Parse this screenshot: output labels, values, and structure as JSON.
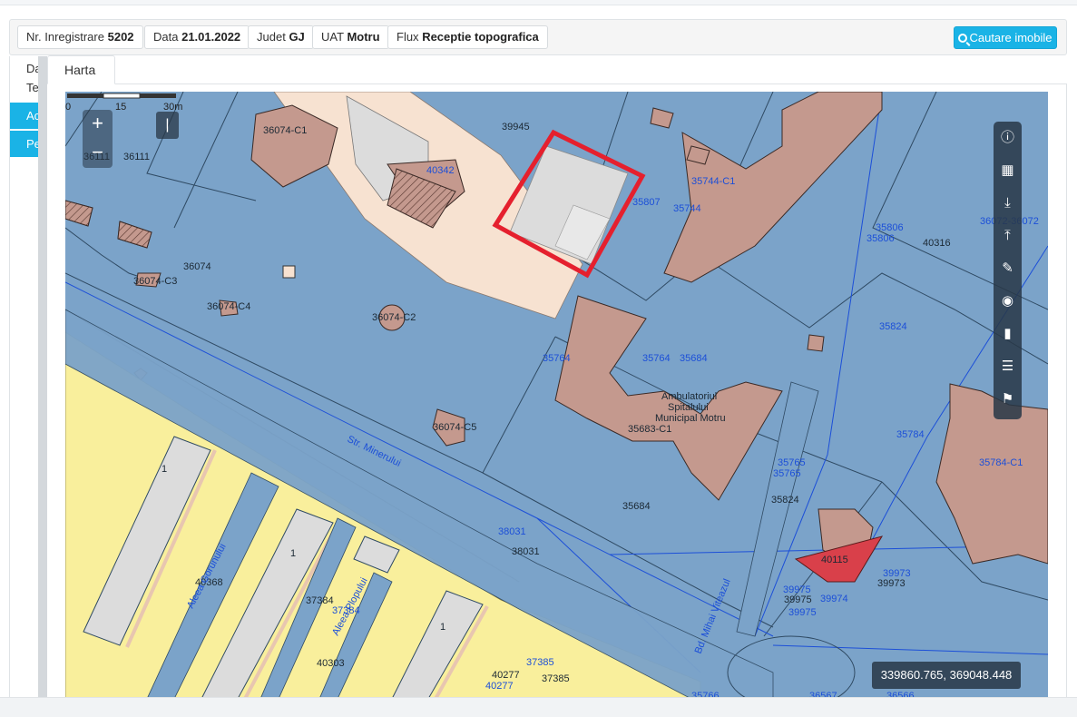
{
  "infobar": {
    "items": [
      {
        "label": "Nr. Inregistrare",
        "value": "5202"
      },
      {
        "label": "Data",
        "value": "21.01.2022"
      },
      {
        "label": "Judet",
        "value": "GJ"
      },
      {
        "label": "UAT",
        "value": "Motru"
      },
      {
        "label": "Flux",
        "value": "Receptie topografica"
      }
    ],
    "search_button": "Cautare imobile",
    "search_icon": "search-icon"
  },
  "left_panel": {
    "text1": "Da",
    "text2": "Te",
    "blue1": "Ac",
    "blue2": "Pe"
  },
  "tabs": [
    {
      "label": "Harta"
    }
  ],
  "map": {
    "zoom_in": "+",
    "zoom_out": "−",
    "layer_toggle": "|",
    "tools": [
      "info-icon",
      "table-icon",
      "download-icon",
      "upload-icon",
      "edit-icon",
      "globe-icon",
      "map-icon",
      "layers-icon",
      "tag-icon"
    ],
    "scale_labels": [
      "0",
      "15",
      "30m"
    ],
    "coordinates": "339860.765, 369048.448",
    "labels": {
      "p36074c1a": "36074-C1",
      "p39945": "39945",
      "p36111a": "36111",
      "p36111b": "36111",
      "p40342": "40342",
      "p35807": "35807",
      "p35744": "35744",
      "p35744c": "35744-C1",
      "p36074": "36074",
      "p36074c3": "36074-C3",
      "p36074c4": "36074-C4",
      "p36074c2": "36074-C2",
      "p36074c5": "36074-C5",
      "p35806a": "35806",
      "p35806b": "35806",
      "p40316": "40316",
      "p36072": "36072-36072",
      "p35824a": "35824",
      "p35764a": "35764",
      "p35764b": "35764",
      "p35684a": "35684",
      "p35684b": "35684",
      "amb1": "Ambulatoriul",
      "amb2": "Spitalului",
      "amb3": "Municipal Motru",
      "p35683": "35683-C1",
      "p35765a": "35765",
      "p35765b": "35765",
      "p35824b": "35824",
      "p35784a": "35784",
      "p35784b": "35784",
      "p35784c1": "35784-C1",
      "street1": "Str. Minerului",
      "street2": "Aleea Gorunului",
      "street3": "Aleea Plopului",
      "street4": "Bd. Mihai Viteazul",
      "p38031a": "38031",
      "p38031b": "38031",
      "p40368": "40368",
      "p37384a": "37384",
      "p37384b": "37384",
      "p40303": "40303",
      "p40277a": "40277",
      "p40277b": "40277",
      "p37385a": "37385",
      "p37385b": "37385",
      "p39973a": "39973",
      "p39973b": "39973",
      "p39975a": "39975",
      "p39975b": "39975",
      "p39975c": "39975",
      "p39974": "39974",
      "p40115": "40115",
      "one1": "1",
      "one2": "1",
      "one3": "1",
      "p36567": "36567",
      "p36566": "36566",
      "p35766": "35766"
    }
  },
  "colors": {
    "parcel_blue": "#7ba3c9",
    "building_pink": "#c4998e",
    "street_yellow": "#f9ef9c",
    "highlight_red": "#e5202e",
    "accent_cyan": "#1ab3e6"
  }
}
